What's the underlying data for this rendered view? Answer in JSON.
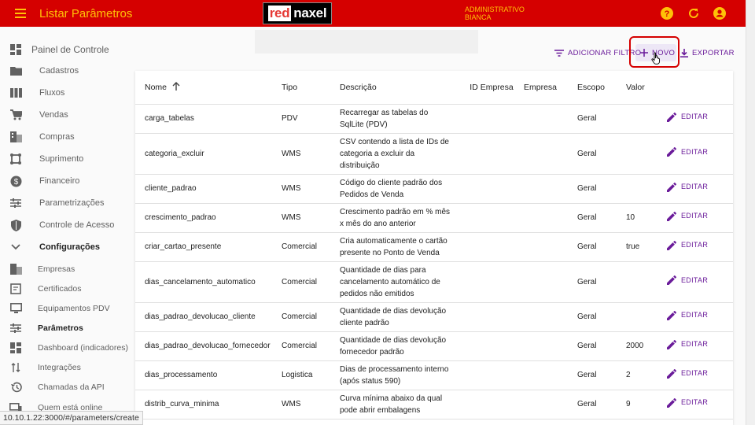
{
  "appbar": {
    "title": "Listar Parâmetros",
    "logo_part1": "red",
    "logo_part2": "naxel",
    "user_role": "ADMINISTRATIVO",
    "user_name": "BIANCA"
  },
  "sidebar": {
    "items": [
      {
        "label": "Painel de Controle",
        "icon": "dashboard-icon"
      },
      {
        "label": "Cadastros",
        "icon": "folder-icon"
      },
      {
        "label": "Fluxos",
        "icon": "columns-icon"
      },
      {
        "label": "Vendas",
        "icon": "cart-icon"
      },
      {
        "label": "Compras",
        "icon": "building-icon"
      },
      {
        "label": "Suprimento",
        "icon": "supply-icon"
      },
      {
        "label": "Financeiro",
        "icon": "money-icon"
      },
      {
        "label": "Parametrizações",
        "icon": "sliders-icon"
      },
      {
        "label": "Controle de Acesso",
        "icon": "shield-icon"
      },
      {
        "label": "Configurações",
        "icon": "chevron-down-icon"
      },
      {
        "label": "Empresas",
        "icon": "building-icon"
      },
      {
        "label": "Certificados",
        "icon": "certificate-icon"
      },
      {
        "label": "Equipamentos PDV",
        "icon": "monitor-icon"
      },
      {
        "label": "Parâmetros",
        "icon": "sliders-icon"
      },
      {
        "label": "Dashboard (indicadores)",
        "icon": "dashboard-icon"
      },
      {
        "label": "Integrações",
        "icon": "sync-arrows-icon"
      },
      {
        "label": "Chamadas da API",
        "icon": "history-icon"
      },
      {
        "label": "Quem está online",
        "icon": "devices-icon"
      }
    ]
  },
  "toolbar": {
    "filter_label": "ADICIONAR FILTRO",
    "new_label": "NOVO",
    "export_label": "EXPORTAR"
  },
  "table": {
    "columns": {
      "nome": "Nome",
      "tipo": "Tipo",
      "descricao": "Descrição",
      "id_empresa": "ID Empresa",
      "empresa": "Empresa",
      "escopo": "Escopo",
      "valor": "Valor"
    },
    "edit_label": "EDITAR",
    "rows": [
      {
        "nome": "carga_tabelas",
        "tipo": "PDV",
        "descricao": "Recarregar as tabelas do SqlLite (PDV)",
        "escopo": "Geral",
        "valor": ""
      },
      {
        "nome": "categoria_excluir",
        "tipo": "WMS",
        "descricao": "CSV contendo a lista de IDs de categoria a excluir da distribuição",
        "escopo": "Geral",
        "valor": ""
      },
      {
        "nome": "cliente_padrao",
        "tipo": "WMS",
        "descricao": "Código do cliente padrão dos Pedidos de Venda",
        "escopo": "Geral",
        "valor": ""
      },
      {
        "nome": "crescimento_padrao",
        "tipo": "WMS",
        "descricao": "Crescimento padrão em % mês x mês do ano anterior",
        "escopo": "Geral",
        "valor": "10"
      },
      {
        "nome": "criar_cartao_presente",
        "tipo": "Comercial",
        "descricao": "Cria automaticamente o cartão presente no Ponto de Venda",
        "escopo": "Geral",
        "valor": "true"
      },
      {
        "nome": "dias_cancelamento_automatico",
        "tipo": "Comercial",
        "descricao": "Quantidade de dias para cancelamento automático de pedidos não emitidos",
        "escopo": "Geral",
        "valor": ""
      },
      {
        "nome": "dias_padrao_devolucao_cliente",
        "tipo": "Comercial",
        "descricao": "Quantidade de dias devolução cliente padrão",
        "escopo": "Geral",
        "valor": ""
      },
      {
        "nome": "dias_padrao_devolucao_fornecedor",
        "tipo": "Comercial",
        "descricao": "Quantidade de dias devolução fornecedor padrão",
        "escopo": "Geral",
        "valor": "2000"
      },
      {
        "nome": "dias_processamento",
        "tipo": "Logistica",
        "descricao": "Dias de processamento interno (após status 590)",
        "escopo": "Geral",
        "valor": "2"
      },
      {
        "nome": "distrib_curva_minima",
        "tipo": "WMS",
        "descricao": "Curva mínima abaixo da qual pode abrir embalagens",
        "escopo": "Geral",
        "valor": "9"
      }
    ]
  },
  "status_bar": {
    "url": "10.10.1.22:3000/#/parameters/create"
  },
  "colors": {
    "appbar": "#d50000",
    "accent": "#ffc107",
    "primary": "#6a1b9a"
  }
}
